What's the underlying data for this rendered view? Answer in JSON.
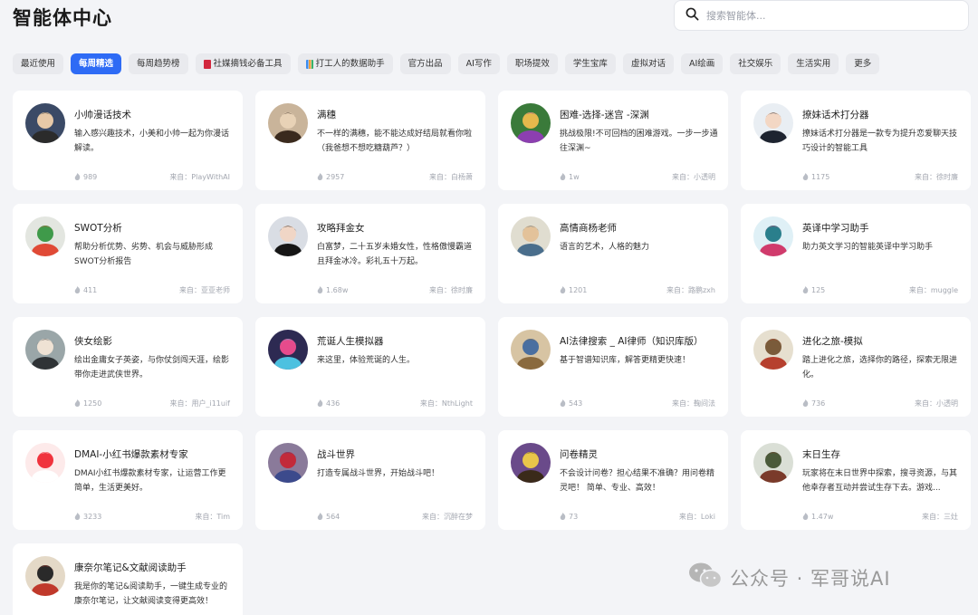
{
  "page": {
    "title": "智能体中心"
  },
  "search": {
    "placeholder": "搜索智能体..."
  },
  "tabs": [
    {
      "label": "最近使用",
      "icon": ""
    },
    {
      "label": "每周精选",
      "icon": "",
      "active": true
    },
    {
      "label": "每周趋势榜",
      "icon": ""
    },
    {
      "label": "社媒摘钱必备工具",
      "icon": "red-book-icon"
    },
    {
      "label": "打工人的数据助手",
      "icon": "bar-chart-icon"
    },
    {
      "label": "官方出品",
      "icon": ""
    },
    {
      "label": "AI写作",
      "icon": ""
    },
    {
      "label": "职场提效",
      "icon": ""
    },
    {
      "label": "学生宝库",
      "icon": ""
    },
    {
      "label": "虚拟对话",
      "icon": ""
    },
    {
      "label": "AI绘画",
      "icon": ""
    },
    {
      "label": "社交娱乐",
      "icon": ""
    },
    {
      "label": "生活实用",
      "icon": ""
    },
    {
      "label": "更多",
      "icon": ""
    }
  ],
  "cards": [
    {
      "title": "小帅漫话技术",
      "desc": "输入感兴趣技术，小美和小帅一起为你漫话解读。",
      "count": "989",
      "source": "来自：PlayWithAI",
      "avatar": {
        "bg": "#3b4a66",
        "fg": "#e7c9a8",
        "accent": "#2b2b2b"
      }
    },
    {
      "title": "满穗",
      "desc": "不一样的满穗，能不能达成好结局就看你啦（我爸想不想吃糖葫芦？）",
      "count": "2957",
      "source": "来自：白杨萧",
      "avatar": {
        "bg": "#c9b49a",
        "fg": "#e8d2b6",
        "accent": "#3a2a1e"
      }
    },
    {
      "title": "困难-选择-迷宫 -深渊",
      "desc": "挑战极限!不可回档的困难游戏。一步一步通往深渊~",
      "count": "1w",
      "source": "来自：小透明",
      "avatar": {
        "bg": "#3a7a3a",
        "fg": "#e6b84c",
        "accent": "#8c3fb0"
      }
    },
    {
      "title": "撩妹话术打分器",
      "desc": "撩妹话术打分器是一款专为提升恋爱聊天技巧设计的智能工具",
      "count": "1175",
      "source": "来自：徐时廉",
      "avatar": {
        "bg": "#e9eef3",
        "fg": "#f3d7c4",
        "accent": "#1e2430"
      }
    },
    {
      "title": "SWOT分析",
      "desc": "帮助分析优势、劣势、机会与威胁形成SWOT分析报告",
      "count": "411",
      "source": "来自：亚亚老师",
      "avatar": {
        "bg": "#e3e6e0",
        "fg": "#3f9a4a",
        "accent": "#e04a36"
      }
    },
    {
      "title": "攻略拜金女",
      "desc": "白富梦，二十五岁未婚女性，性格傲慢霸道且拜金冰冷。彩礼五十万起。",
      "count": "1.68w",
      "source": "来自：徐时廉",
      "avatar": {
        "bg": "#d9dde4",
        "fg": "#f0d6c6",
        "accent": "#161616"
      }
    },
    {
      "title": "高情商杨老师",
      "desc": "语言的艺术，人格的魅力",
      "count": "1201",
      "source": "来自：路鹏zxh",
      "avatar": {
        "bg": "#e0ddd0",
        "fg": "#e3c29a",
        "accent": "#4a6e8c"
      }
    },
    {
      "title": "英译中学习助手",
      "desc": "助力英文学习的智能英译中学习助手",
      "count": "125",
      "source": "来自：muggle",
      "avatar": {
        "bg": "#dff0f6",
        "fg": "#2a7f8c",
        "accent": "#d03b6c"
      }
    },
    {
      "title": "侠女绘影",
      "desc": "绘出金庸女子英姿，与你仗剑闯天涯，绘影带你走进武侠世界。",
      "count": "1250",
      "source": "来自：用户_i11uif",
      "avatar": {
        "bg": "#9aa6a8",
        "fg": "#efe2d4",
        "accent": "#2f3336"
      }
    },
    {
      "title": "荒诞人生模拟器",
      "desc": "来这里，体验荒诞的人生。",
      "count": "436",
      "source": "来自：NthLight",
      "avatar": {
        "bg": "#2d2a52",
        "fg": "#e64b8c",
        "accent": "#4cc1e0"
      }
    },
    {
      "title": "AI法律搜索 _ AI律师（知识库版）",
      "desc": "基于智谱知识库，解答更精更快速！",
      "count": "543",
      "source": "来自：鞠间法",
      "avatar": {
        "bg": "#d7c4a3",
        "fg": "#4a6fa0",
        "accent": "#8a6a3e"
      }
    },
    {
      "title": "进化之旅-模拟",
      "desc": "踏上进化之旅，选择你的路径，探索无限进化。",
      "count": "736",
      "source": "来自：小透明",
      "avatar": {
        "bg": "#e6dfcf",
        "fg": "#7a5b3a",
        "accent": "#b6402e"
      }
    },
    {
      "title": "DMAI-小红书爆款素材专家",
      "desc": "DMAI小红书爆款素材专家，让运营工作更简单，生活更美好。",
      "count": "3233",
      "source": "来自：Tim",
      "avatar": {
        "bg": "#fdeaea",
        "fg": "#f0333d",
        "accent": "#ffffff"
      }
    },
    {
      "title": "战斗世界",
      "desc": "打造专属战斗世界，开始战斗吧！",
      "count": "564",
      "source": "来自：沉醉在梦",
      "avatar": {
        "bg": "#8a7a9a",
        "fg": "#c22a3a",
        "accent": "#3c4a8c"
      }
    },
    {
      "title": "问卷精灵",
      "desc": "不会设计问卷？担心结果不准确？用问卷精灵吧！ 简单、专业、高效！",
      "count": "73",
      "source": "来自：Loki",
      "avatar": {
        "bg": "#6a4a8a",
        "fg": "#e9c64a",
        "accent": "#3a2a1a"
      }
    },
    {
      "title": "末日生存",
      "desc": "玩家将在末日世界中探索，搜寻资源，与其他幸存者互动并尝试生存下去。游戏...",
      "count": "1.47w",
      "source": "来自：三灶",
      "avatar": {
        "bg": "#dadfd6",
        "fg": "#4a5a3a",
        "accent": "#7a3a2a"
      }
    },
    {
      "title": "康奈尔笔记&文献阅读助手",
      "desc": "我是你的笔记&阅读助手，一键生成专业的康奈尔笔记，让文献阅读变得更高效！",
      "count": "",
      "source": "",
      "avatar": {
        "bg": "#e4d9c7",
        "fg": "#2a2a2a",
        "accent": "#c0392b"
      }
    }
  ],
  "watermark": {
    "text": "公众号 · 军哥说AI"
  }
}
